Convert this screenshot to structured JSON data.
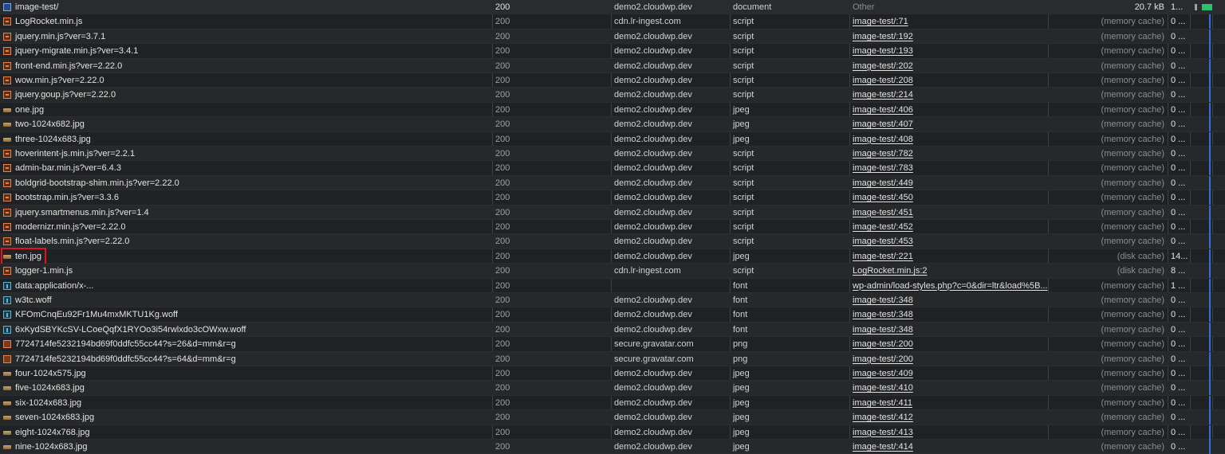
{
  "rows": [
    {
      "name": "image-test/",
      "icon": "document-icon",
      "kind": "doc",
      "status": "200",
      "domain": "demo2.cloudwp.dev",
      "type": "document",
      "initiator": "Other",
      "initiator_link": false,
      "size": "20.7 kB",
      "size_cached": false,
      "time": "1..."
    },
    {
      "name": "LogRocket.min.js",
      "icon": "script-icon",
      "kind": "script",
      "status": "200",
      "domain": "cdn.lr-ingest.com",
      "type": "script",
      "initiator": "image-test/:71",
      "initiator_link": true,
      "size": "(memory cache)",
      "size_cached": true,
      "time": "0 ..."
    },
    {
      "name": "jquery.min.js?ver=3.7.1",
      "icon": "script-icon",
      "kind": "script",
      "status": "200",
      "domain": "demo2.cloudwp.dev",
      "type": "script",
      "initiator": "image-test/:192",
      "initiator_link": true,
      "size": "(memory cache)",
      "size_cached": true,
      "time": "0 ..."
    },
    {
      "name": "jquery-migrate.min.js?ver=3.4.1",
      "icon": "script-icon",
      "kind": "script",
      "status": "200",
      "domain": "demo2.cloudwp.dev",
      "type": "script",
      "initiator": "image-test/:193",
      "initiator_link": true,
      "size": "(memory cache)",
      "size_cached": true,
      "time": "0 ..."
    },
    {
      "name": "front-end.min.js?ver=2.22.0",
      "icon": "script-icon",
      "kind": "script",
      "status": "200",
      "domain": "demo2.cloudwp.dev",
      "type": "script",
      "initiator": "image-test/:202",
      "initiator_link": true,
      "size": "(memory cache)",
      "size_cached": true,
      "time": "0 ..."
    },
    {
      "name": "wow.min.js?ver=2.22.0",
      "icon": "script-icon",
      "kind": "script",
      "status": "200",
      "domain": "demo2.cloudwp.dev",
      "type": "script",
      "initiator": "image-test/:208",
      "initiator_link": true,
      "size": "(memory cache)",
      "size_cached": true,
      "time": "0 ..."
    },
    {
      "name": "jquery.goup.js?ver=2.22.0",
      "icon": "script-icon",
      "kind": "script",
      "status": "200",
      "domain": "demo2.cloudwp.dev",
      "type": "script",
      "initiator": "image-test/:214",
      "initiator_link": true,
      "size": "(memory cache)",
      "size_cached": true,
      "time": "0 ..."
    },
    {
      "name": "one.jpg",
      "icon": "image-icon",
      "kind": "img",
      "status": "200",
      "domain": "demo2.cloudwp.dev",
      "type": "jpeg",
      "initiator": "image-test/:406",
      "initiator_link": true,
      "size": "(memory cache)",
      "size_cached": true,
      "time": "0 ..."
    },
    {
      "name": "two-1024x682.jpg",
      "icon": "image-icon",
      "kind": "img",
      "status": "200",
      "domain": "demo2.cloudwp.dev",
      "type": "jpeg",
      "initiator": "image-test/:407",
      "initiator_link": true,
      "size": "(memory cache)",
      "size_cached": true,
      "time": "0 ..."
    },
    {
      "name": "three-1024x683.jpg",
      "icon": "image-icon",
      "kind": "img",
      "status": "200",
      "domain": "demo2.cloudwp.dev",
      "type": "jpeg",
      "initiator": "image-test/:408",
      "initiator_link": true,
      "size": "(memory cache)",
      "size_cached": true,
      "time": "0 ..."
    },
    {
      "name": "hoverintent-js.min.js?ver=2.2.1",
      "icon": "script-icon",
      "kind": "script",
      "status": "200",
      "domain": "demo2.cloudwp.dev",
      "type": "script",
      "initiator": "image-test/:782",
      "initiator_link": true,
      "size": "(memory cache)",
      "size_cached": true,
      "time": "0 ..."
    },
    {
      "name": "admin-bar.min.js?ver=6.4.3",
      "icon": "script-icon",
      "kind": "script",
      "status": "200",
      "domain": "demo2.cloudwp.dev",
      "type": "script",
      "initiator": "image-test/:783",
      "initiator_link": true,
      "size": "(memory cache)",
      "size_cached": true,
      "time": "0 ..."
    },
    {
      "name": "boldgrid-bootstrap-shim.min.js?ver=2.22.0",
      "icon": "script-icon",
      "kind": "script",
      "status": "200",
      "domain": "demo2.cloudwp.dev",
      "type": "script",
      "initiator": "image-test/:449",
      "initiator_link": true,
      "size": "(memory cache)",
      "size_cached": true,
      "time": "0 ..."
    },
    {
      "name": "bootstrap.min.js?ver=3.3.6",
      "icon": "script-icon",
      "kind": "script",
      "status": "200",
      "domain": "demo2.cloudwp.dev",
      "type": "script",
      "initiator": "image-test/:450",
      "initiator_link": true,
      "size": "(memory cache)",
      "size_cached": true,
      "time": "0 ..."
    },
    {
      "name": "jquery.smartmenus.min.js?ver=1.4",
      "icon": "script-icon",
      "kind": "script",
      "status": "200",
      "domain": "demo2.cloudwp.dev",
      "type": "script",
      "initiator": "image-test/:451",
      "initiator_link": true,
      "size": "(memory cache)",
      "size_cached": true,
      "time": "0 ..."
    },
    {
      "name": "modernizr.min.js?ver=2.22.0",
      "icon": "script-icon",
      "kind": "script",
      "status": "200",
      "domain": "demo2.cloudwp.dev",
      "type": "script",
      "initiator": "image-test/:452",
      "initiator_link": true,
      "size": "(memory cache)",
      "size_cached": true,
      "time": "0 ..."
    },
    {
      "name": "float-labels.min.js?ver=2.22.0",
      "icon": "script-icon",
      "kind": "script",
      "status": "200",
      "domain": "demo2.cloudwp.dev",
      "type": "script",
      "initiator": "image-test/:453",
      "initiator_link": true,
      "size": "(memory cache)",
      "size_cached": true,
      "time": "0 ..."
    },
    {
      "name": "ten.jpg",
      "icon": "image-icon",
      "kind": "img",
      "status": "200",
      "domain": "demo2.cloudwp.dev",
      "type": "jpeg",
      "initiator": "image-test/:221",
      "initiator_link": true,
      "size": "(disk cache)",
      "size_cached": true,
      "time": "14...",
      "highlighted": true
    },
    {
      "name": "logger-1.min.js",
      "icon": "script-icon",
      "kind": "script",
      "status": "200",
      "domain": "cdn.lr-ingest.com",
      "type": "script",
      "initiator": "LogRocket.min.js:2",
      "initiator_link": true,
      "size": "(disk cache)",
      "size_cached": true,
      "time": "8 ..."
    },
    {
      "name": "data:application/x-...",
      "icon": "font-icon",
      "kind": "font",
      "status": "200",
      "domain": "",
      "type": "font",
      "initiator": "wp-admin/load-styles.php?c=0&dir=ltr&load%5B...",
      "initiator_link": true,
      "size": "(memory cache)",
      "size_cached": true,
      "time": "1 ..."
    },
    {
      "name": "w3tc.woff",
      "icon": "font-icon",
      "kind": "font",
      "status": "200",
      "domain": "demo2.cloudwp.dev",
      "type": "font",
      "initiator": "image-test/:348",
      "initiator_link": true,
      "size": "(memory cache)",
      "size_cached": true,
      "time": "0 ..."
    },
    {
      "name": "KFOmCnqEu92Fr1Mu4mxMKTU1Kg.woff",
      "icon": "font-icon",
      "kind": "font",
      "status": "200",
      "domain": "demo2.cloudwp.dev",
      "type": "font",
      "initiator": "image-test/:348",
      "initiator_link": true,
      "size": "(memory cache)",
      "size_cached": true,
      "time": "0 ..."
    },
    {
      "name": "6xKydSBYKcSV-LCoeQqfX1RYOo3i54rwlxdo3cOWxw.woff",
      "icon": "font-icon",
      "kind": "font",
      "status": "200",
      "domain": "demo2.cloudwp.dev",
      "type": "font",
      "initiator": "image-test/:348",
      "initiator_link": true,
      "size": "(memory cache)",
      "size_cached": true,
      "time": "0 ..."
    },
    {
      "name": "7724714fe5232194bd69f0ddfc55cc44?s=26&d=mm&r=g",
      "icon": "png-icon",
      "kind": "png",
      "status": "200",
      "domain": "secure.gravatar.com",
      "type": "png",
      "initiator": "image-test/:200",
      "initiator_link": true,
      "size": "(memory cache)",
      "size_cached": true,
      "time": "0 ..."
    },
    {
      "name": "7724714fe5232194bd69f0ddfc55cc44?s=64&d=mm&r=g",
      "icon": "png-icon",
      "kind": "png",
      "status": "200",
      "domain": "secure.gravatar.com",
      "type": "png",
      "initiator": "image-test/:200",
      "initiator_link": true,
      "size": "(memory cache)",
      "size_cached": true,
      "time": "0 ..."
    },
    {
      "name": "four-1024x575.jpg",
      "icon": "image-icon",
      "kind": "img",
      "status": "200",
      "domain": "demo2.cloudwp.dev",
      "type": "jpeg",
      "initiator": "image-test/:409",
      "initiator_link": true,
      "size": "(memory cache)",
      "size_cached": true,
      "time": "0 ..."
    },
    {
      "name": "five-1024x683.jpg",
      "icon": "image-icon",
      "kind": "img",
      "status": "200",
      "domain": "demo2.cloudwp.dev",
      "type": "jpeg",
      "initiator": "image-test/:410",
      "initiator_link": true,
      "size": "(memory cache)",
      "size_cached": true,
      "time": "0 ..."
    },
    {
      "name": "six-1024x683.jpg",
      "icon": "image-icon",
      "kind": "img",
      "status": "200",
      "domain": "demo2.cloudwp.dev",
      "type": "jpeg",
      "initiator": "image-test/:411",
      "initiator_link": true,
      "size": "(memory cache)",
      "size_cached": true,
      "time": "0 ..."
    },
    {
      "name": "seven-1024x683.jpg",
      "icon": "image-icon",
      "kind": "img",
      "status": "200",
      "domain": "demo2.cloudwp.dev",
      "type": "jpeg",
      "initiator": "image-test/:412",
      "initiator_link": true,
      "size": "(memory cache)",
      "size_cached": true,
      "time": "0 ..."
    },
    {
      "name": "eight-1024x768.jpg",
      "icon": "image-icon",
      "kind": "img",
      "status": "200",
      "domain": "demo2.cloudwp.dev",
      "type": "jpeg",
      "initiator": "image-test/:413",
      "initiator_link": true,
      "size": "(memory cache)",
      "size_cached": true,
      "time": "0 ..."
    },
    {
      "name": "nine-1024x683.jpg",
      "icon": "image-icon",
      "kind": "img",
      "status": "200",
      "domain": "demo2.cloudwp.dev",
      "type": "jpeg",
      "initiator": "image-test/:414",
      "initiator_link": true,
      "size": "(memory cache)",
      "size_cached": true,
      "time": "0 ..."
    }
  ],
  "colors": {
    "background": "#202124",
    "highlight_border": "#e0141d",
    "waterfall_green": "#2fbf71",
    "waterfall_blue": "#2f6fe0"
  }
}
